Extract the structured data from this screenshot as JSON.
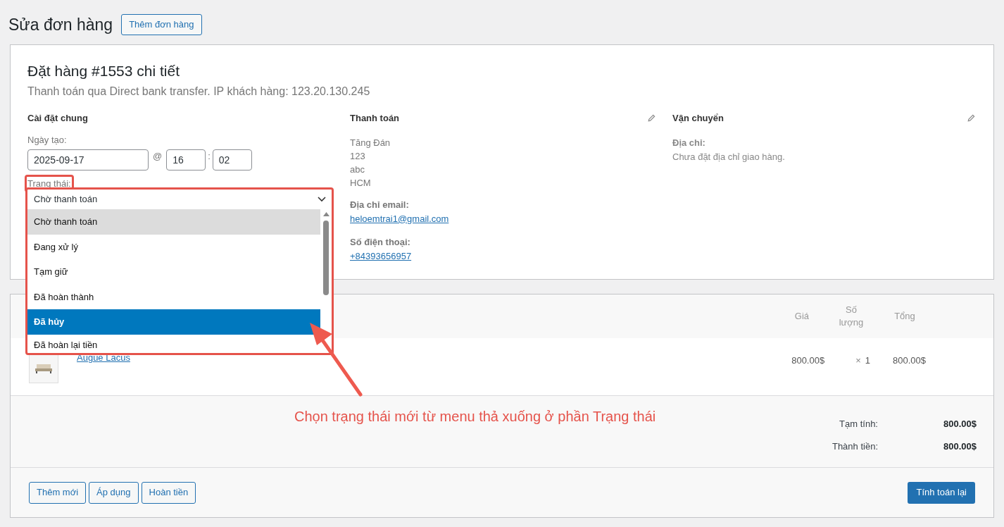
{
  "page": {
    "title": "Sửa đơn hàng",
    "add_button": "Thêm đơn hàng"
  },
  "order": {
    "title": "Đặt hàng #1553 chi tiết",
    "subtitle": "Thanh toán qua Direct bank transfer. IP khách hàng: 123.20.130.245",
    "general": {
      "heading": "Cài đặt chung",
      "date_label": "Ngày tạo:",
      "date": "2025-09-17",
      "at": "@",
      "hour": "16",
      "colon": ":",
      "minute": "02",
      "status_label": "Trạng thái:"
    },
    "billing": {
      "heading": "Thanh toán",
      "address_lines": [
        "Tăng Đán",
        "123",
        "abc",
        "HCM"
      ],
      "email_label": "Địa chỉ email:",
      "email": "heloemtrai1@gmail.com",
      "phone_label": "Số điện thoại:",
      "phone": "+84393656957"
    },
    "shipping": {
      "heading": "Vận chuyển",
      "address_label": "Địa chỉ:",
      "address": "Chưa đặt địa chỉ giao hàng."
    }
  },
  "status_select": {
    "value": "Chờ thanh toán",
    "options": [
      {
        "label": "Chờ thanh toán",
        "selected": true,
        "highlighted": false
      },
      {
        "label": "Đang xử lý",
        "selected": false,
        "highlighted": false
      },
      {
        "label": "Tạm giữ",
        "selected": false,
        "highlighted": false
      },
      {
        "label": "Đã hoàn thành",
        "selected": false,
        "highlighted": false
      },
      {
        "label": "Đã hủy",
        "selected": false,
        "highlighted": true
      },
      {
        "label": "Đã hoàn lại tiền",
        "selected": false,
        "highlighted": false
      }
    ]
  },
  "items": {
    "columns": [
      "Giá",
      "Số lượng",
      "Tổng"
    ],
    "rows": [
      {
        "name": "Augue Lacus",
        "price": "800.00$",
        "times": "×",
        "qty": "1",
        "total": "800.00$"
      }
    ],
    "totals": [
      {
        "label": "Tạm tính:",
        "value": "800.00$"
      },
      {
        "label": "Thành tiền:",
        "value": "800.00$"
      }
    ],
    "buttons": [
      "Thêm mới",
      "Áp dụng",
      "Hoàn tiền"
    ],
    "recalc_button": "Tính toán lại"
  },
  "annotation": "Chọn trạng thái mới từ menu thả xuống ở phần Trạng thái"
}
